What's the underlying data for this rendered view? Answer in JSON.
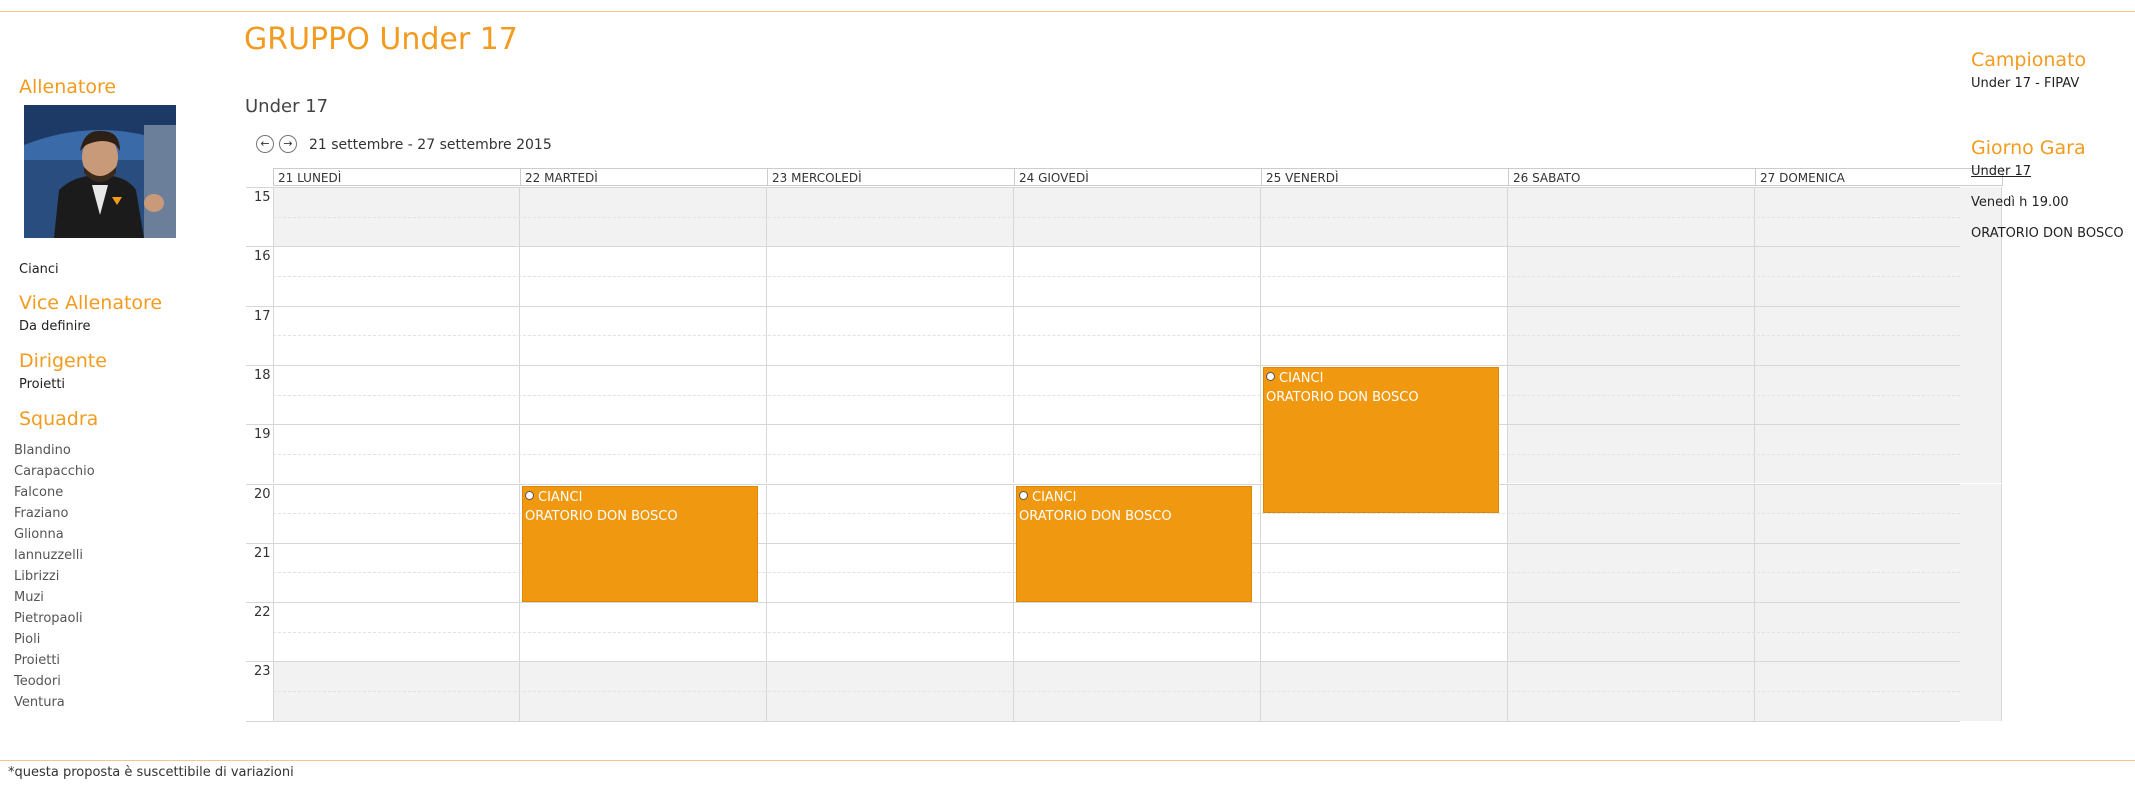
{
  "header": {
    "title": "GRUPPO Under 17",
    "subtitle": "Under 17"
  },
  "nav": {
    "prev_icon": "arrow-left-icon",
    "next_icon": "arrow-right-icon",
    "range": "21 settembre - 27 settembre 2015"
  },
  "staff": {
    "coach_title": "Allenatore",
    "coach_name": "Cianci",
    "vice_title": "Vice Allenatore",
    "vice_name": "Da definire",
    "manager_title": "Dirigente",
    "manager_name": "Proietti"
  },
  "team": {
    "title": "Squadra",
    "players": [
      "Blandino",
      "Carapacchio",
      "Falcone",
      "Fraziano",
      "Glionna",
      "Iannuzzelli",
      "Librizzi",
      "Muzi",
      "Pietropaoli",
      "Pioli",
      "Proietti",
      "Teodori",
      "Ventura"
    ]
  },
  "calendar": {
    "days": [
      "21 LUNEDÌ",
      "22 MARTEDÌ",
      "23 MERCOLEDÌ",
      "24 GIOVEDÌ",
      "25 VENERDÌ",
      "26 SABATO",
      "27 DOMENICA"
    ],
    "hours": [
      "15",
      "16",
      "17",
      "18",
      "19",
      "20",
      "21",
      "22",
      "23"
    ],
    "events": [
      {
        "day_index": 1,
        "start": 20,
        "end": 22,
        "coach": "CIANCI",
        "place": "ORATORIO DON BOSCO",
        "icon": "ball-icon"
      },
      {
        "day_index": 3,
        "start": 20,
        "end": 22,
        "coach": "CIANCI",
        "place": "ORATORIO DON BOSCO",
        "icon": "ball-icon"
      },
      {
        "day_index": 4,
        "start": 18,
        "end": 20.5,
        "coach": "CIANCI",
        "place": "ORATORIO DON BOSCO",
        "icon": "ball-icon"
      }
    ]
  },
  "sidebar_right": {
    "league_title": "Campionato",
    "league_value": "Under 17 - FIPAV",
    "match_title": "Giorno Gara",
    "match_link": "Under 17",
    "match_time": "Venedì h 19.00",
    "match_place": "ORATORIO DON BOSCO"
  },
  "footer": {
    "note": "*questa proposta è suscettibile di variazioni"
  },
  "colors": {
    "accent": "#f29b1f",
    "event": "#f0980f",
    "off_hours": "#f2f2f2"
  }
}
